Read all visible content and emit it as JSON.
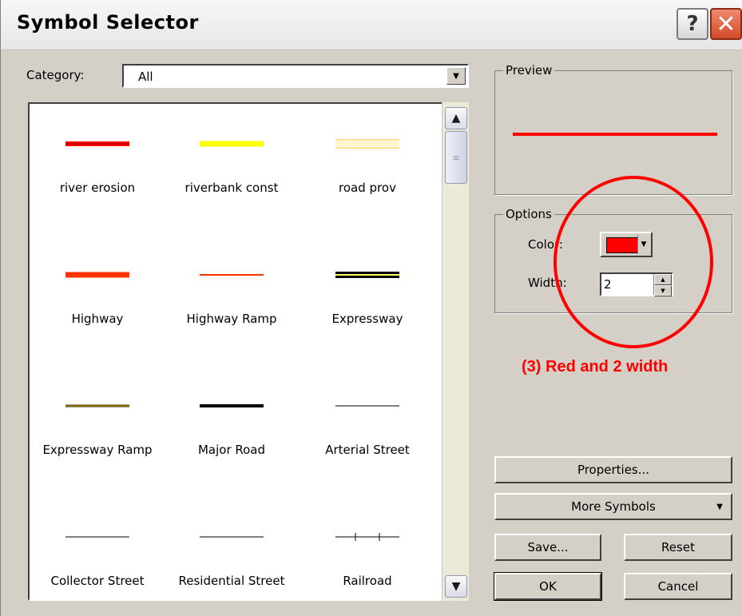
{
  "window": {
    "title": "Symbol Selector",
    "help_glyph": "?",
    "close_glyph": "✕"
  },
  "category": {
    "label": "Category:",
    "selected": "All"
  },
  "symbols": [
    {
      "label": "river erosion",
      "color": "#ff0000",
      "style": "thick"
    },
    {
      "label": "riverbank const",
      "color": "#ffff00",
      "style": "thick"
    },
    {
      "label": "road prov",
      "color": "#ffeaa0",
      "style": "double"
    },
    {
      "label": "Highway",
      "color": "#ff3300",
      "style": "thick"
    },
    {
      "label": "Highway Ramp",
      "color": "#ff3300",
      "style": "medium"
    },
    {
      "label": "Expressway",
      "color": "#000000",
      "style": "cased-yellow"
    },
    {
      "label": "Expressway Ramp",
      "color": "#8b7500",
      "style": "thin-cased"
    },
    {
      "label": "Major Road",
      "color": "#000000",
      "style": "thick-black"
    },
    {
      "label": "Arterial Street",
      "color": "#000000",
      "style": "thin"
    },
    {
      "label": "Collector Street",
      "color": "#000000",
      "style": "thin"
    },
    {
      "label": "Residential Street",
      "color": "#000000",
      "style": "thin"
    },
    {
      "label": "Railroad",
      "color": "#000000",
      "style": "railroad"
    }
  ],
  "preview": {
    "legend": "Preview",
    "line_color": "#ff0000"
  },
  "options": {
    "legend": "Options",
    "color_label": "Color:",
    "color_value": "#ff0000",
    "width_label": "Width:",
    "width_value": "2"
  },
  "buttons": {
    "properties": "Properties...",
    "more_symbols": "More Symbols",
    "save": "Save...",
    "reset": "Reset",
    "ok": "OK",
    "cancel": "Cancel"
  },
  "annotation": {
    "text": "(3)  Red and 2 width",
    "color": "#ff0000"
  }
}
